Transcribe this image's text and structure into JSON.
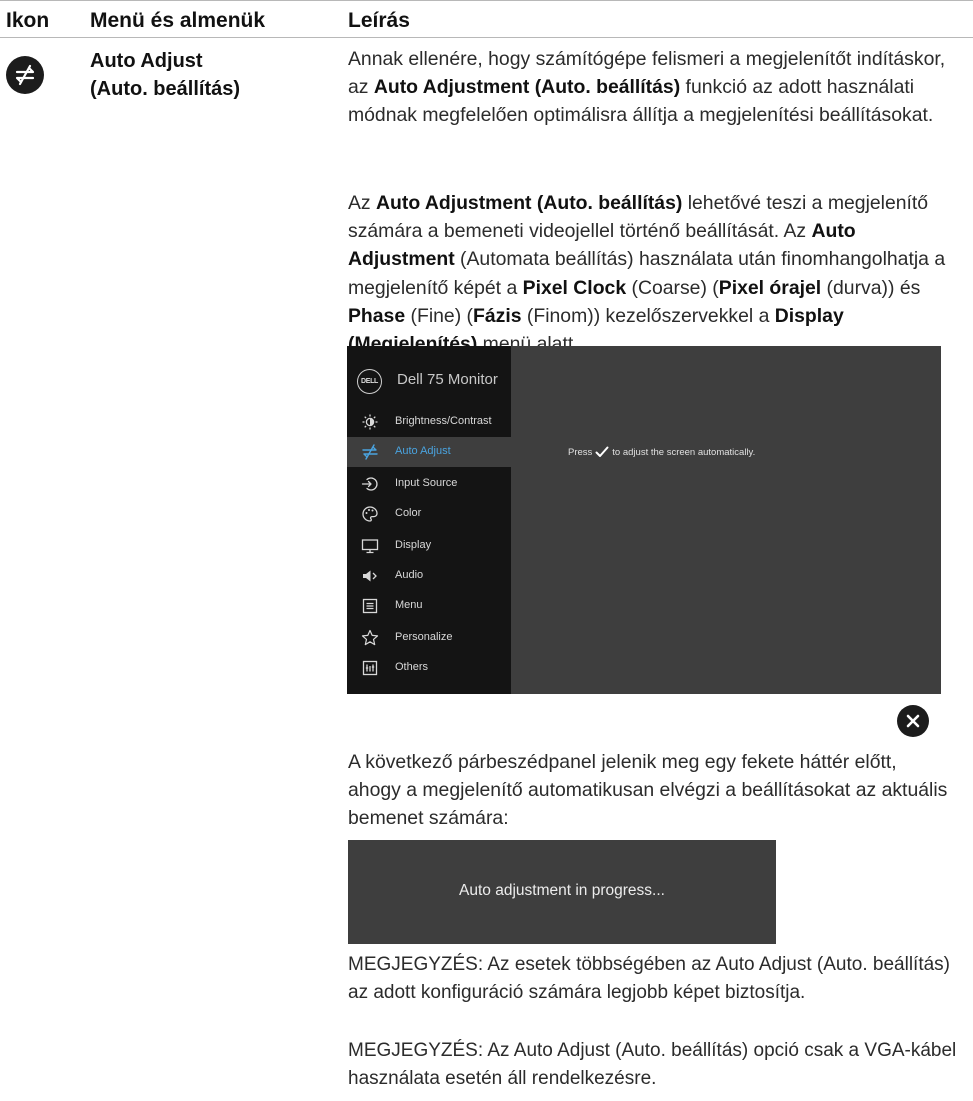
{
  "table_header": {
    "icon_col": "Ikon",
    "menu_col": "Menü és almenük",
    "desc_col": "Leírás"
  },
  "row": {
    "icon": "auto-adjust-icon",
    "menu_name": "Auto Adjust\n(Auto. beállítás)"
  },
  "paragraph1": {
    "p1": "Annak ellenére, hogy számítógépe felismeri a megjelenítőt indításkor, az ",
    "b1": "Auto Adjustment (Auto. beállítás)",
    "p2": " funkció az adott használati módnak megfelelően optimálisra állítja a megjelenítési beállításokat."
  },
  "paragraph2": {
    "p1": "Az ",
    "b1": "Auto Adjustment (Auto. beállítás)",
    "p2": " lehetővé teszi a megjelenítő számára a bemeneti videojellel történő beállítását. Az ",
    "b2": "Auto Adjustment",
    "p3": " (Automata beállítás) használata után finomhangolhatja a megjelenítő képét a ",
    "b3": "Pixel Clock",
    "p4": " (Coarse) (",
    "b4": "Pixel órajel",
    "p5": " (durva)) és ",
    "b5": "Phase",
    "p6": " (Fine) (",
    "b6": "Fázis",
    "p7": " (Finom)) kezelőszervekkel a ",
    "b7": "Display (Megjelenítés)",
    "p8": " menü alatt."
  },
  "osd": {
    "logo": "DELL",
    "title": "Dell 75 Monitor",
    "items": [
      {
        "label": "Brightness/Contrast",
        "icon": "brightness-icon"
      },
      {
        "label": "Auto Adjust",
        "icon": "auto-adjust-icon"
      },
      {
        "label": "Input Source",
        "icon": "input-source-icon"
      },
      {
        "label": "Color",
        "icon": "color-palette-icon"
      },
      {
        "label": "Display",
        "icon": "display-icon"
      },
      {
        "label": "Audio",
        "icon": "audio-icon"
      },
      {
        "label": "Menu",
        "icon": "menu-icon"
      },
      {
        "label": "Personalize",
        "icon": "star-icon"
      },
      {
        "label": "Others",
        "icon": "others-icon"
      }
    ],
    "active_item": "Auto Adjust",
    "message_before": "Press",
    "message_after": "to adjust the screen automatically.",
    "accent_color": "#4aa3df"
  },
  "close_icon": "close-icon",
  "paragraph3": "A következő párbeszédpanel jelenik meg egy fekete háttér előtt, ahogy a megjelenítő automatikusan elvégzi a beállításokat az aktuális bemenet számára:",
  "progress_message": "Auto adjustment in progress...",
  "note1": "MEGJEGYZÉS: Az esetek többségében az Auto Adjust (Auto. beállítás) az adott konfiguráció számára legjobb képet biztosítja.",
  "note2": "MEGJEGYZÉS: Az Auto Adjust (Auto. beállítás) opció csak a VGA-kábel használata esetén áll rendelkezésre."
}
